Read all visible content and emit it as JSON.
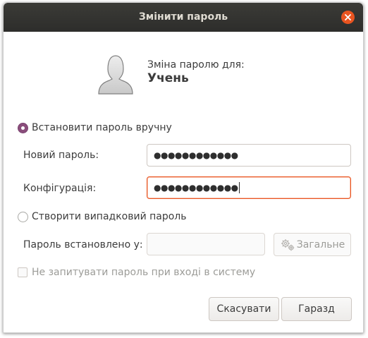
{
  "window": {
    "title": "Змінити пароль"
  },
  "header": {
    "subtitle": "Зміна паролю для:",
    "username": "Учень"
  },
  "manual": {
    "radio_label": "Встановити пароль вручну",
    "new_password_label": "Новий пароль:",
    "new_password_value": "●●●●●●●●●●●●",
    "confirm_label": "Конфігурація:",
    "confirm_value": "●●●●●●●●●●●●"
  },
  "random": {
    "radio_label": "Створити випадковий пароль",
    "set_to_label": "Пароль встановлено у:",
    "set_to_value": "",
    "generate_button": "Загальне"
  },
  "login_checkbox_label": "Не запитувати пароль при вході в систему",
  "buttons": {
    "cancel": "Скасувати",
    "ok": "Гаразд"
  },
  "colors": {
    "titlebar": "#2d2d2b",
    "accent_orange": "#e95420",
    "radio_selected": "#8a4d7b"
  },
  "icons": {
    "close": "close-icon",
    "avatar": "user-avatar-icon",
    "generate": "gears-icon"
  }
}
